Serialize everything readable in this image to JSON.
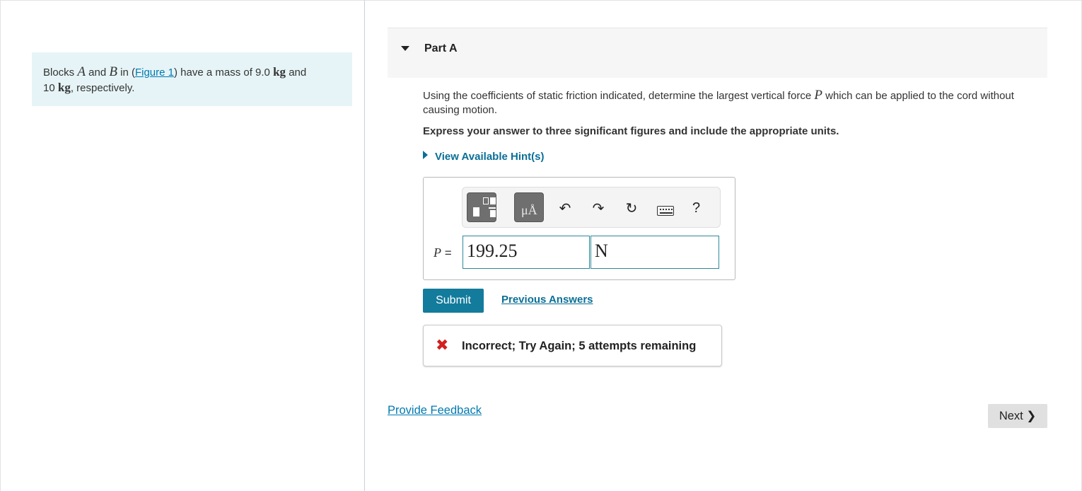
{
  "problem": {
    "t1": "Blocks ",
    "var_a": "A",
    "t2": " and ",
    "var_b": "B",
    "t3": " in (",
    "figure_link": "Figure 1",
    "t4": ") have a mass of 9.0 ",
    "unit1": "kg",
    "t5": " and",
    "t6": "10 ",
    "unit2": "kg",
    "t7": ", respectively."
  },
  "part": {
    "title": "Part A",
    "question_pre": "Using the coefficients of static friction indicated, determine the largest vertical force ",
    "question_var": "P",
    "question_post": " which can be applied to the cord without causing motion.",
    "instruction": "Express your answer to three significant figures and include the appropriate units.",
    "hint_label": "View Available Hint(s)"
  },
  "answer": {
    "var": "P",
    "equals": " =",
    "value": "199.25",
    "unit": "N",
    "toolbar": {
      "units_button": "μÅ",
      "help": "?"
    }
  },
  "actions": {
    "submit": "Submit",
    "previous_answers": "Previous Answers"
  },
  "feedback": {
    "message": "Incorrect; Try Again; 5 attempts remaining",
    "status_color": "#d21f1f"
  },
  "footer": {
    "provide_feedback": "Provide Feedback",
    "next": "Next ❯"
  }
}
